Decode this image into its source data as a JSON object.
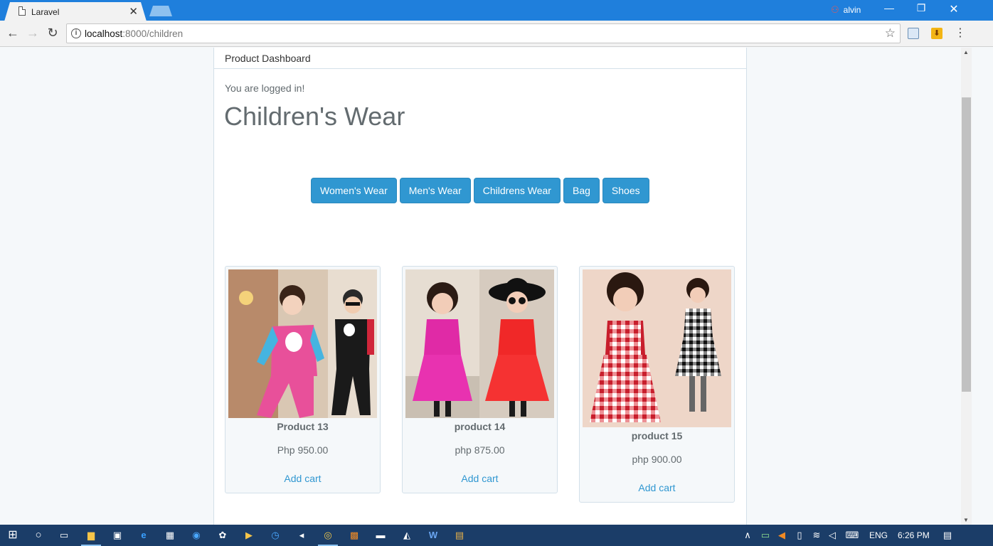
{
  "browser": {
    "tab_title": "Laravel",
    "tab_close": "✕",
    "user_name": "alvin",
    "url_host": "localhost",
    "url_rest": ":8000/children"
  },
  "page": {
    "panel_heading": "Product Dashboard",
    "status_text": "You are logged in!",
    "title": "Children's Wear",
    "categories": [
      {
        "label": "Women's Wear"
      },
      {
        "label": "Men's Wear"
      },
      {
        "label": "Childrens Wear"
      },
      {
        "label": "Bag"
      },
      {
        "label": "Shoes"
      }
    ],
    "products": [
      {
        "name": "Product 13",
        "price": "Php 950.00",
        "action": "Add cart"
      },
      {
        "name": "product 14",
        "price": "php 875.00",
        "action": "Add cart"
      },
      {
        "name": "product 15",
        "price": "php 900.00",
        "action": "Add cart"
      }
    ]
  },
  "taskbar": {
    "language": "ENG",
    "time": "6:26 PM"
  },
  "colors": {
    "primary": "#3097d1",
    "text": "#636b6f",
    "chrome_blue": "#1f7fdc",
    "taskbar": "#1b3d68"
  }
}
